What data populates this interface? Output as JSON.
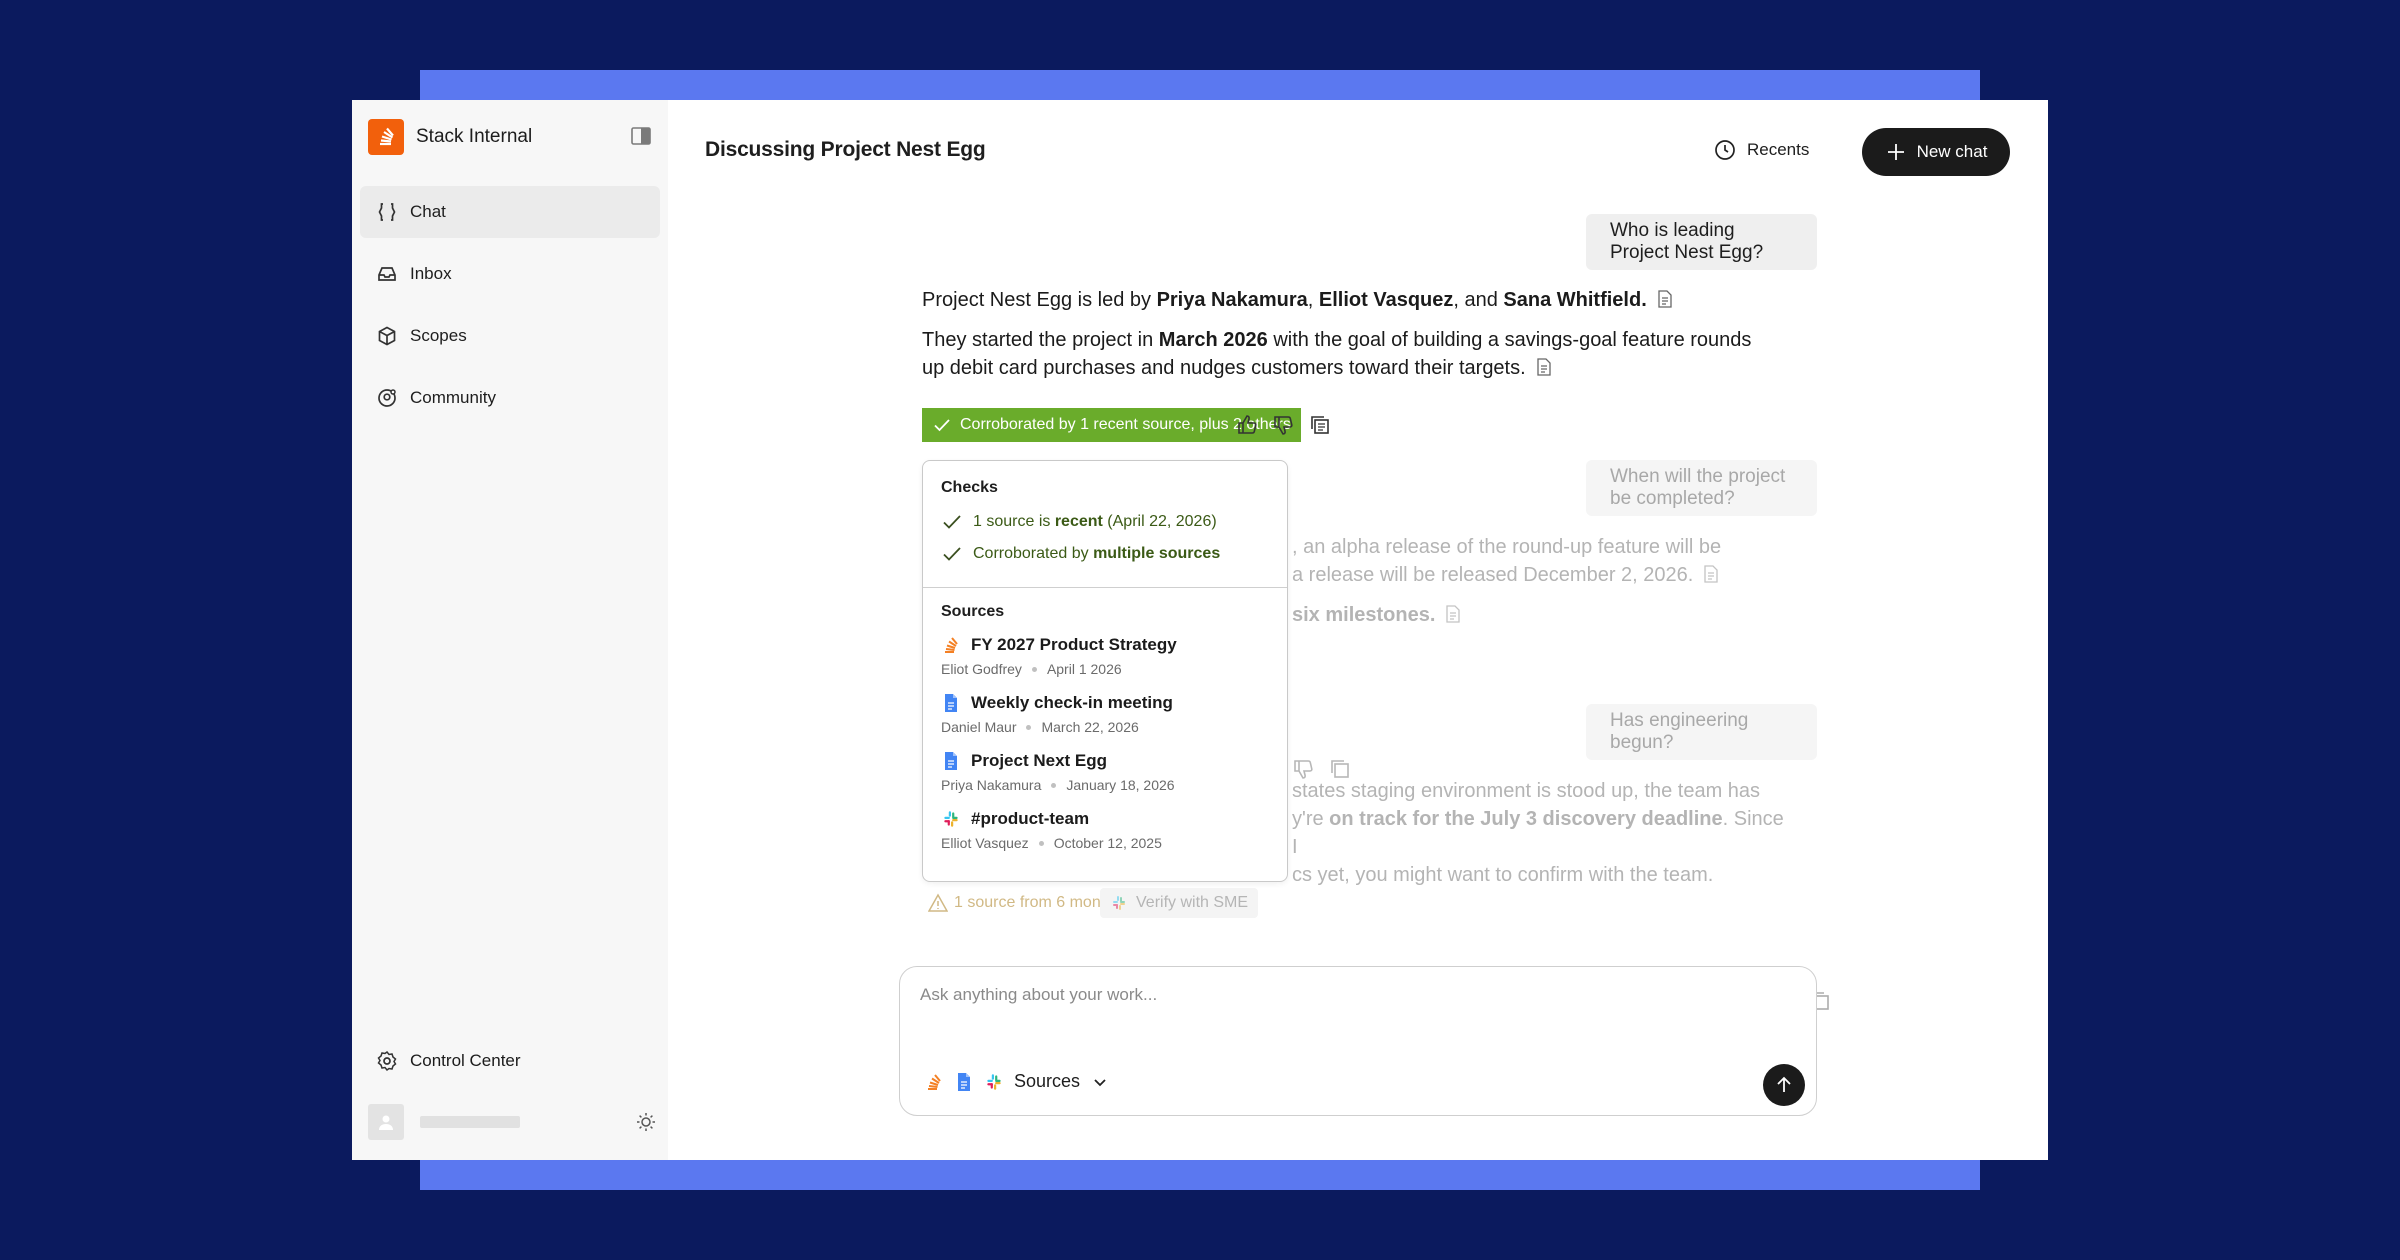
{
  "app": {
    "name": "Stack Internal"
  },
  "sidebar": {
    "items": [
      {
        "label": "Chat",
        "icon": "braces-icon",
        "active": true
      },
      {
        "label": "Inbox",
        "icon": "inbox-icon"
      },
      {
        "label": "Scopes",
        "icon": "cube-icon"
      },
      {
        "label": "Community",
        "icon": "community-icon"
      }
    ],
    "control_center": "Control Center"
  },
  "header": {
    "title": "Discussing Project Nest Egg",
    "recents": "Recents",
    "new_chat": "New chat"
  },
  "conversation": {
    "q1": "Who is leading Project Nest Egg?",
    "a1": {
      "p1_pre": "Project Nest Egg is led by ",
      "p1_name1": "Priya Nakamura",
      "p1_sep1": ", ",
      "p1_name2": "Elliot Vasquez",
      "p1_sep2": ", and ",
      "p1_name3": "Sana Whitfield.",
      "p2_pre": "They started the project in ",
      "p2_date": "March 2026",
      "p2_post": " with the goal of building a savings-goal feature rounds up debit card purchases and nudges customers toward their targets."
    },
    "badge": "Corroborated by 1 recent source, plus 2 others",
    "q2": "When will the project be completed?",
    "a2": {
      "line1": ", an alpha release of the round-up feature will be",
      "line2": "a release will be released December 2, 2026.",
      "line3_bold": "six milestones."
    },
    "q3": "Has engineering begun?",
    "a3": {
      "line1": "states staging environment is stood up, the team has",
      "line2_pre": "y're ",
      "line2_bold": "on track for the July 3 discovery deadline",
      "line2_post": ". Since I",
      "line3": "cs yet, you might want to confirm with the team."
    },
    "warning": "1 source from 6 months ago",
    "verify_sme": "Verify with SME"
  },
  "popover": {
    "checks_title": "Checks",
    "check1_pre": "1 source is ",
    "check1_bold": "recent",
    "check1_post": " (April 22, 2026)",
    "check2_pre": "Corroborated by ",
    "check2_bold": "multiple sources",
    "sources_title": "Sources",
    "sources": [
      {
        "title": "FY 2027 Product Strategy",
        "author": "Eliot Godfrey",
        "date": "April 1 2026",
        "icon": "stack-overflow-icon"
      },
      {
        "title": "Weekly check-in meeting",
        "author": "Daniel Maur",
        "date": "March 22, 2026",
        "icon": "google-doc-icon"
      },
      {
        "title": "Project Next Egg",
        "author": "Priya Nakamura",
        "date": "January 18, 2026",
        "icon": "google-doc-icon"
      },
      {
        "title": "#product-team",
        "author": "Elliot Vasquez",
        "date": "October 12, 2025",
        "icon": "slack-icon"
      }
    ]
  },
  "composer": {
    "placeholder": "Ask anything about your work...",
    "sources_label": "Sources"
  },
  "colors": {
    "background": "#0b1a5e",
    "accent_band": "#5b78f0",
    "brand": "#f2600c",
    "badge_green": "#6aac2b",
    "dark": "#1b1b1b"
  }
}
